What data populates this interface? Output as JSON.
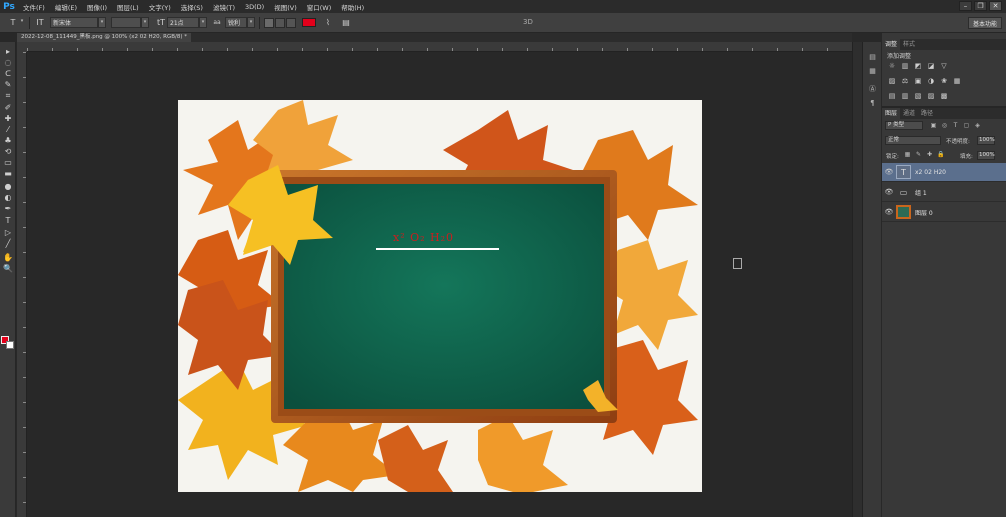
{
  "app": {
    "logo": "Ps",
    "menu": [
      "文件(F)",
      "编辑(E)",
      "图像(I)",
      "图层(L)",
      "文字(Y)",
      "选择(S)",
      "滤镜(T)",
      "3D(D)",
      "视图(V)",
      "窗口(W)",
      "帮助(H)"
    ],
    "window_controls": [
      "–",
      "❐",
      "✕"
    ]
  },
  "options": {
    "tool_icon": "T",
    "orient_icon": "IT",
    "font_family": "新宋体",
    "font_style": "",
    "size_icon": "tT",
    "font_size": "21点",
    "aa_icon": "aa",
    "antialias": "锐利",
    "color_hex": "#e3001b",
    "threed": "3D",
    "workspace": "基本功能"
  },
  "document": {
    "tab_title": "2022-12-08_111449_黑板.png @ 100% (x2 02 H20, RGB/8) *",
    "formula_display": "x² O₂ H₂0",
    "formula_color": "#cc1e1e",
    "board_color": "#0e5b46",
    "frame_color": "#b75d1e"
  },
  "tools": [
    "move-tool",
    "marquee-tool",
    "lasso-tool",
    "quick-select-tool",
    "crop-tool",
    "eyedropper-tool",
    "healing-tool",
    "brush-tool",
    "stamp-tool",
    "history-brush-tool",
    "eraser-tool",
    "gradient-tool",
    "blur-tool",
    "dodge-tool",
    "pen-tool",
    "type-tool",
    "path-select-tool",
    "line-tool",
    "hand-tool",
    "zoom-tool"
  ],
  "tool_glyphs": [
    "▸",
    "◌",
    "ᑕ",
    "✎",
    "⌗",
    "✐",
    "✚",
    "⁄",
    "♣",
    "⟲",
    "▭",
    "▬",
    "●",
    "◐",
    "✒",
    "T",
    "▷",
    "╱",
    "✋",
    "🔍"
  ],
  "strip_icons": [
    "▤",
    "▦",
    "Ⓐ",
    "¶"
  ],
  "adjust": {
    "tabs": [
      "调整",
      "样式"
    ],
    "title": "添加调整",
    "row1": [
      "☼",
      "▥",
      "◩",
      "◪",
      "▽"
    ],
    "row2": [
      "▨",
      "⚖",
      "▣",
      "◑",
      "❀",
      "▦"
    ],
    "row3": [
      "▤",
      "▥",
      "▧",
      "▨",
      "▩"
    ]
  },
  "layers_panel": {
    "tabs": [
      "图层",
      "通道",
      "路径"
    ],
    "filter": "P 类型",
    "filter_icons": [
      "▣",
      "◎",
      "T",
      "▢",
      "◈"
    ],
    "blend_mode": "正常",
    "opacity_label": "不透明度:",
    "opacity": "100%",
    "lock_label": "锁定:",
    "lock_icons": [
      "▦",
      "✎",
      "✚",
      "🔒"
    ],
    "fill_label": "填充:",
    "fill": "100%",
    "layers": [
      {
        "name": "x2 02 H20",
        "type": "text",
        "glyph": "T",
        "selected": true
      },
      {
        "name": "组 1",
        "type": "group",
        "glyph": "▭",
        "selected": false
      },
      {
        "name": "图层 0",
        "type": "image",
        "glyph": "",
        "selected": false
      }
    ]
  }
}
